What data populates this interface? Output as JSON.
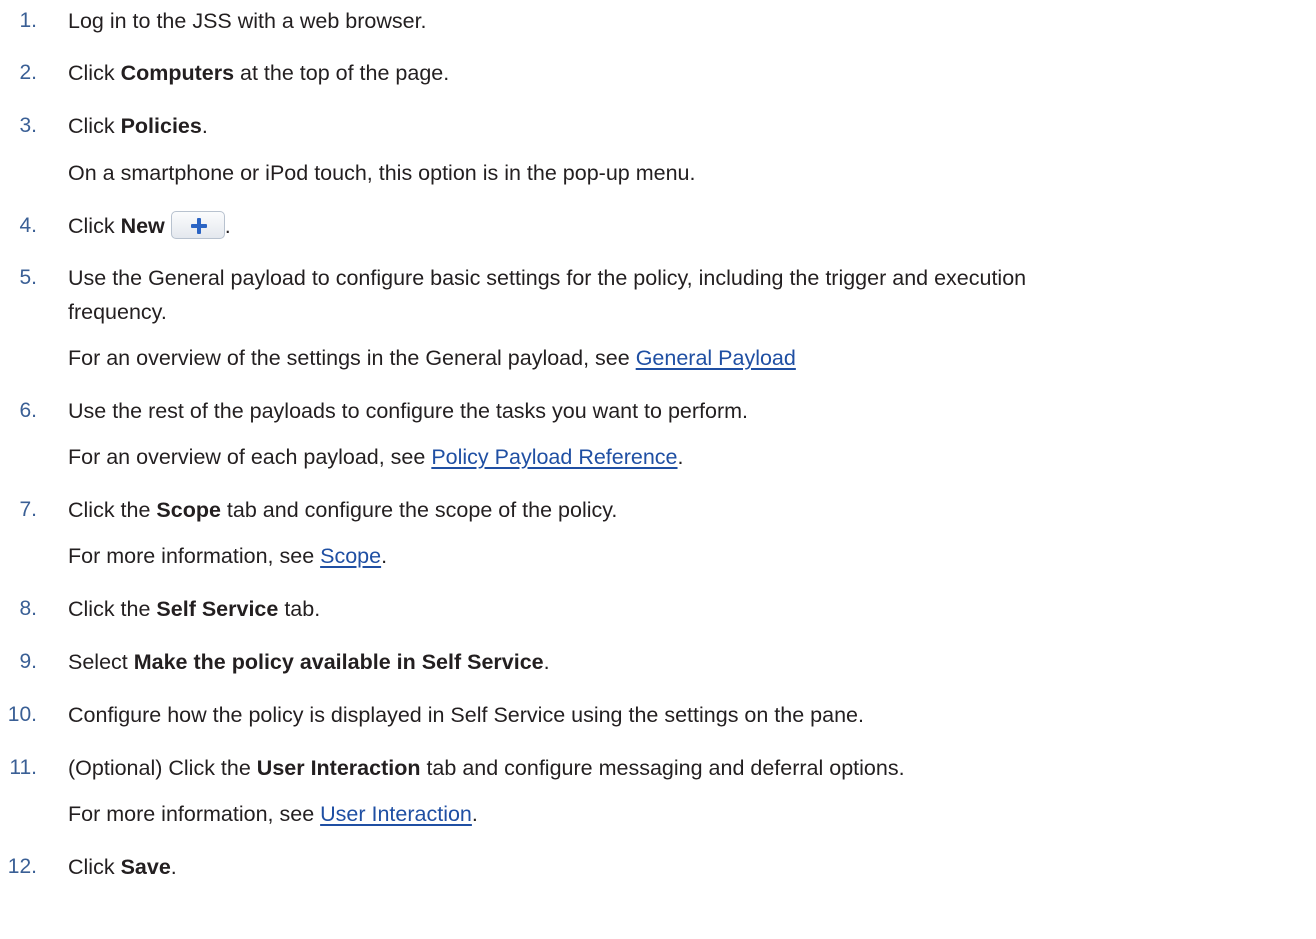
{
  "steps": [
    {
      "number": "1.",
      "lines": [
        {
          "segments": [
            {
              "text": "Log in to the JSS with a web browser."
            }
          ]
        }
      ]
    },
    {
      "number": "2.",
      "lines": [
        {
          "segments": [
            {
              "text": "Click "
            },
            {
              "text": "Computers",
              "bold": true
            },
            {
              "text": " at the top of the page."
            }
          ]
        }
      ]
    },
    {
      "number": "3.",
      "lines": [
        {
          "segments": [
            {
              "text": "Click "
            },
            {
              "text": "Policies",
              "bold": true
            },
            {
              "text": "."
            }
          ]
        },
        {
          "segments": [
            {
              "text": "On a smartphone or iPod touch, this option is in the pop-up menu."
            }
          ]
        }
      ]
    },
    {
      "number": "4.",
      "lines": [
        {
          "segments": [
            {
              "text": "Click "
            },
            {
              "text": "New",
              "bold": true
            },
            {
              "button": "add-icon"
            },
            {
              "text": "."
            }
          ]
        }
      ]
    },
    {
      "number": "5.",
      "lines": [
        {
          "segments": [
            {
              "text": "Use the General payload to configure basic settings for the policy, including the trigger and execution"
            }
          ]
        },
        {
          "segments": [
            {
              "text": "frequency."
            }
          ]
        },
        {
          "segments": [
            {
              "text": "For an overview of the settings in the General payload, see "
            },
            {
              "text": "General Payload",
              "link": true
            }
          ]
        }
      ]
    },
    {
      "number": "6.",
      "lines": [
        {
          "segments": [
            {
              "text": "Use the rest of the payloads to configure the tasks you want to perform."
            }
          ]
        },
        {
          "segments": [
            {
              "text": "For an overview of each payload, see "
            },
            {
              "text": "Policy Payload Reference",
              "link": true
            },
            {
              "text": "."
            }
          ]
        }
      ]
    },
    {
      "number": "7.",
      "lines": [
        {
          "segments": [
            {
              "text": "Click the "
            },
            {
              "text": "Scope",
              "bold": true
            },
            {
              "text": " tab and configure the scope of the policy."
            }
          ]
        },
        {
          "segments": [
            {
              "text": "For more information, see "
            },
            {
              "text": "Scope",
              "link": true
            },
            {
              "text": "."
            }
          ]
        }
      ]
    },
    {
      "number": "8.",
      "lines": [
        {
          "segments": [
            {
              "text": "Click the "
            },
            {
              "text": "Self Service",
              "bold": true
            },
            {
              "text": " tab."
            }
          ]
        }
      ]
    },
    {
      "number": "9.",
      "lines": [
        {
          "segments": [
            {
              "text": "Select "
            },
            {
              "text": "Make the policy available in Self Service",
              "bold": true
            },
            {
              "text": "."
            }
          ]
        }
      ]
    },
    {
      "number": "10.",
      "lines": [
        {
          "segments": [
            {
              "text": "Configure how the policy is displayed in Self Service using the settings on the pane."
            }
          ]
        }
      ]
    },
    {
      "number": "11.",
      "lines": [
        {
          "segments": [
            {
              "text": "(Optional) Click the "
            },
            {
              "text": "User Interaction",
              "bold": true
            },
            {
              "text": " tab and configure messaging and deferral options."
            }
          ]
        },
        {
          "segments": [
            {
              "text": "For more information, see "
            },
            {
              "text": "User Interaction",
              "link": true
            },
            {
              "text": "."
            }
          ]
        }
      ]
    },
    {
      "number": "12.",
      "lines": [
        {
          "segments": [
            {
              "text": "Click "
            },
            {
              "text": "Save",
              "bold": true
            },
            {
              "text": "."
            }
          ]
        }
      ]
    }
  ]
}
